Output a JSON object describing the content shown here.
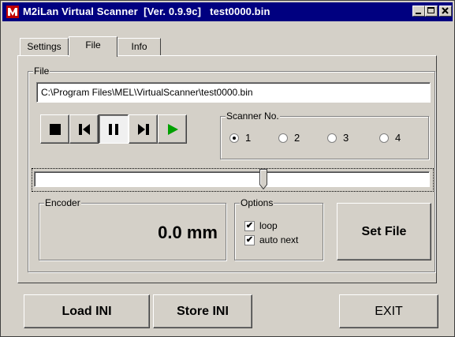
{
  "window": {
    "title": "M2iLan Virtual Scanner  [Ver. 0.9.9c]   test0000.bin"
  },
  "tabs": [
    {
      "label": "Settings"
    },
    {
      "label": "File"
    },
    {
      "label": "Info"
    }
  ],
  "file_group": {
    "label": "File",
    "path": "C:\\Program Files\\MEL\\VirtualScanner\\test0000.bin"
  },
  "transport": {
    "stop_icon": "stop-icon",
    "prev_icon": "skip-back-icon",
    "pause_icon": "pause-icon",
    "next_icon": "skip-forward-icon",
    "play_icon": "play-icon",
    "play_color": "#00a000"
  },
  "scanner": {
    "label": "Scanner No.",
    "options": [
      "1",
      "2",
      "3",
      "4"
    ],
    "selected": "1"
  },
  "slider": {
    "position_fraction": 0.58
  },
  "encoder": {
    "label": "Encoder",
    "value": "0.0 mm"
  },
  "options": {
    "label": "Options",
    "loop_label": "loop",
    "loop_checked": true,
    "auto_next_label": "auto next",
    "auto_next_checked": true
  },
  "buttons": {
    "set_file": "Set File",
    "load_ini": "Load INI",
    "store_ini": "Store INI",
    "exit": "EXIT"
  }
}
